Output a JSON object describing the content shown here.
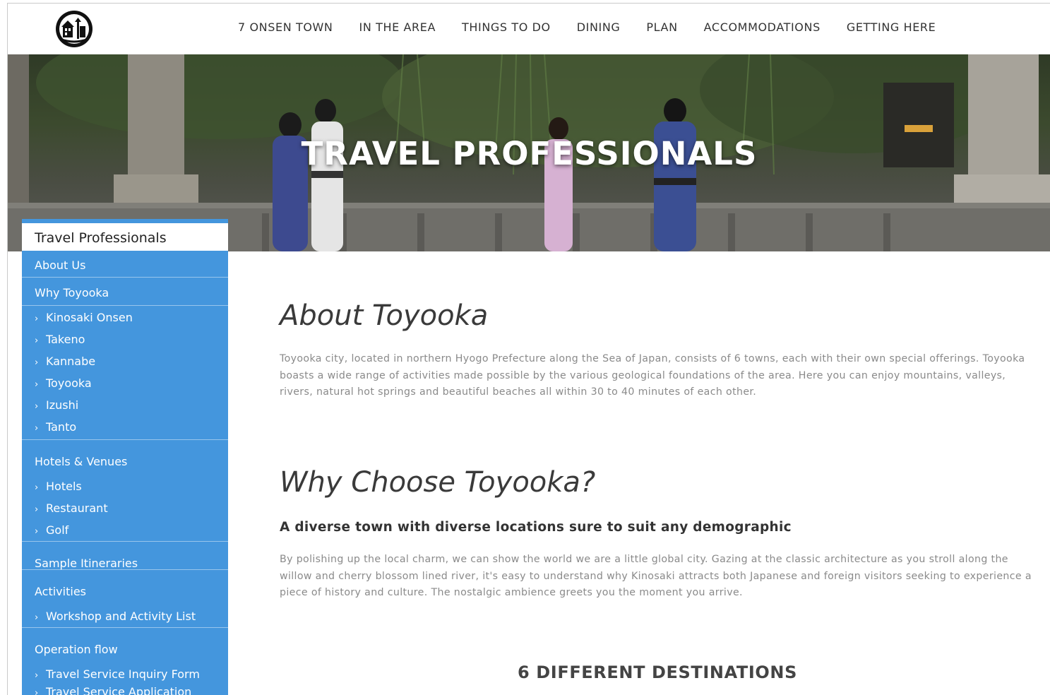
{
  "header": {
    "logo_icon": "hotspring-town-logo-icon",
    "nav": [
      "7 ONSEN TOWN",
      "IN THE AREA",
      "THINGS TO DO",
      "DINING",
      "PLAN",
      "ACCOMMODATIONS",
      "GETTING HERE"
    ]
  },
  "hero": {
    "title": "TRAVEL PROFESSIONALS"
  },
  "sidebar": {
    "heading": "Travel Professionals",
    "accent_color": "#4496dd",
    "items": [
      {
        "label": "About Us",
        "sub": false
      },
      {
        "label": "Why Toyooka",
        "sub": false
      },
      {
        "label": "Kinosaki Onsen",
        "sub": true
      },
      {
        "label": "Takeno",
        "sub": true
      },
      {
        "label": "Kannabe",
        "sub": true
      },
      {
        "label": "Toyooka",
        "sub": true
      },
      {
        "label": "Izushi",
        "sub": true
      },
      {
        "label": "Tanto",
        "sub": true
      },
      {
        "label": "Hotels & Venues",
        "sub": false
      },
      {
        "label": "Hotels",
        "sub": true
      },
      {
        "label": "Restaurant",
        "sub": true
      },
      {
        "label": "Golf",
        "sub": true
      },
      {
        "label": "Sample Itineraries",
        "sub": false
      },
      {
        "label": "Activities",
        "sub": false
      },
      {
        "label": "Workshop and Activity List",
        "sub": true
      },
      {
        "label": "Operation flow",
        "sub": false
      },
      {
        "label": "Travel Service Inquiry Form",
        "sub": true
      },
      {
        "label": "Travel Service Application",
        "sub": true
      }
    ]
  },
  "main": {
    "about_heading": "About Toyooka",
    "about_text": "Toyooka city, located in northern Hyogo Prefecture along the Sea of Japan, consists of 6 towns, each with their own special offerings. Toyooka boasts a wide range of activities made possible by the various geological foundations of the area. Here you can enjoy mountains, valleys, rivers, natural hot springs and beautiful beaches all within 30 to 40 minutes of each other.",
    "why_heading": "Why Choose Toyooka?",
    "why_subheading": "A diverse town with diverse locations sure to suit any demographic",
    "why_text": "By polishing up the local charm, we can show the world we are a little global city. Gazing at the classic architecture as you stroll along the willow and cherry blossom lined river, it's easy to understand why Kinosaki attracts both Japanese and foreign visitors seeking to experience a piece of history and culture. The nostalgic ambience greets you the moment you arrive.",
    "destinations_heading": "6 DIFFERENT DESTINATIONS"
  }
}
